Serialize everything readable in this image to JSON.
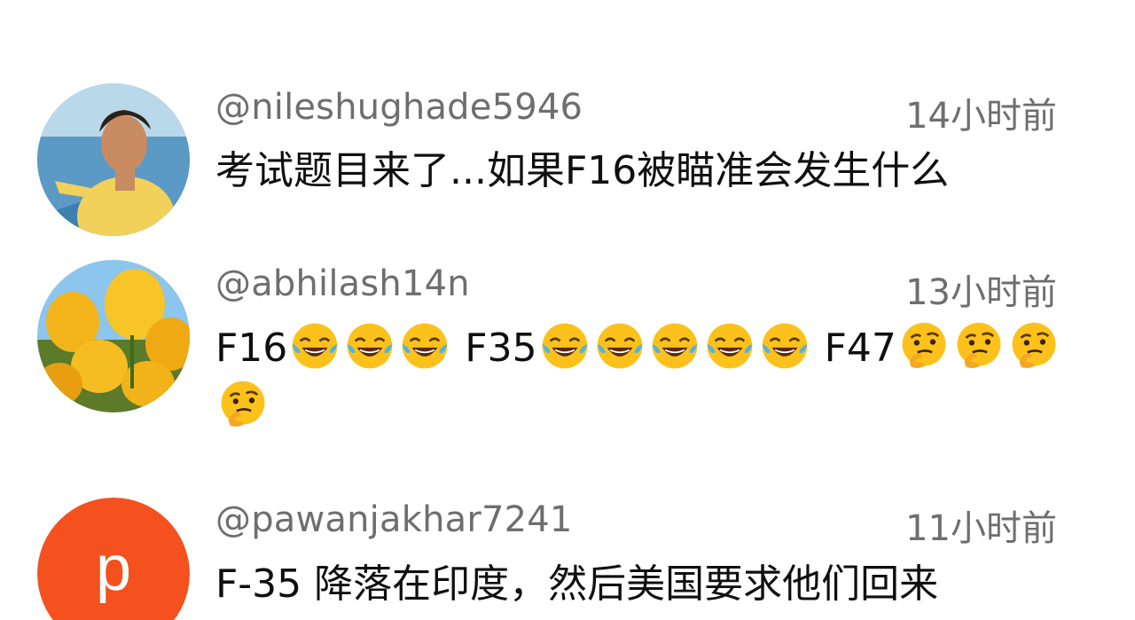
{
  "comments": [
    {
      "username": "@nileshughade5946",
      "time": "14小时前",
      "text": "考试题目来了...如果F16被瞄准会发生什么"
    },
    {
      "username": "@abhilash14n",
      "time": "13小时前",
      "segments": [
        {
          "type": "text",
          "value": "F16"
        },
        {
          "type": "emoji",
          "icon": "laughing-tears-emoji"
        },
        {
          "type": "emoji",
          "icon": "laughing-tears-emoji"
        },
        {
          "type": "emoji",
          "icon": "laughing-tears-emoji"
        },
        {
          "type": "text",
          "value": " F35"
        },
        {
          "type": "emoji",
          "icon": "laughing-tears-emoji"
        },
        {
          "type": "emoji",
          "icon": "laughing-tears-emoji"
        },
        {
          "type": "emoji",
          "icon": "laughing-tears-emoji"
        },
        {
          "type": "emoji",
          "icon": "laughing-tears-emoji"
        },
        {
          "type": "emoji",
          "icon": "laughing-tears-emoji"
        },
        {
          "type": "text",
          "value": " F47"
        },
        {
          "type": "emoji",
          "icon": "thinking-face-emoji"
        },
        {
          "type": "emoji",
          "icon": "thinking-face-emoji"
        },
        {
          "type": "emoji",
          "icon": "thinking-face-emoji"
        },
        {
          "type": "emoji",
          "icon": "thinking-face-emoji"
        }
      ]
    },
    {
      "username": "@pawanjakhar7241",
      "time": "11小时前",
      "avatar_letter": "p",
      "avatar_color": "#f4511e",
      "text": "F-35 降落在印度，然后美国要求他们回来"
    }
  ],
  "colors": {
    "meta": "#6e6e6e",
    "text": "#0f0f0f",
    "background": "#ffffff"
  }
}
